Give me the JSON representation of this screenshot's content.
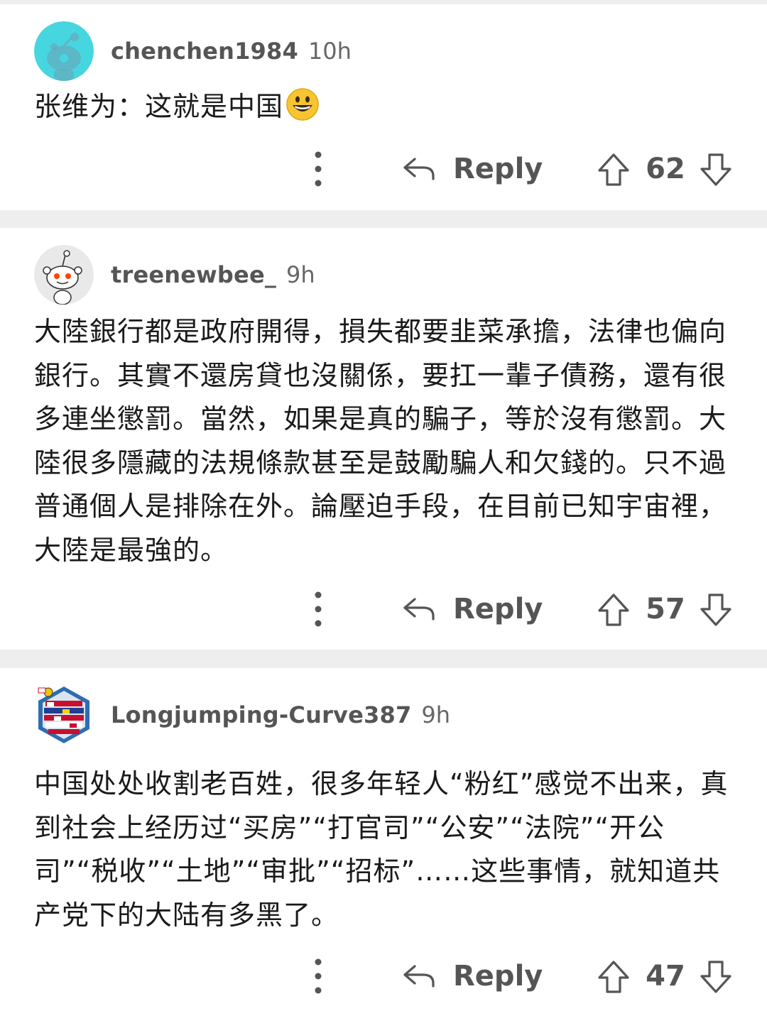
{
  "comments": [
    {
      "author": "chenchen1984",
      "time": "10h",
      "body": "张维为：这就是中国",
      "emoji": "grinning-face",
      "reply_label": "Reply",
      "score": "62",
      "avatar": "snoo-teal-avatar"
    },
    {
      "author": "treenewbee_",
      "time": "9h",
      "body": "大陸銀行都是政府開得，損失都要韭菜承擔，法律也偏向銀行。其實不還房貸也沒關係，要扛一輩子債務，還有很多連坐懲罰。當然，如果是真的騙子，等於沒有懲罰。大陸很多隱藏的法規條款甚至是鼓勵騙人和欠錢的。只不過普通個人是排除在外。論壓迫手段，在目前已知宇宙裡，大陸是最強的。",
      "reply_label": "Reply",
      "score": "57",
      "avatar": "snoo-default-avatar"
    },
    {
      "author": "Longjumping-Curve387",
      "time": "9h",
      "body": "中国处处收割老百姓，很多年轻人“粉红”感觉不出来，真到社会上经历过“买房”“打官司”“公安”“法院”“开公司”“税收”“土地”“审批”“招标”……这些事情，就知道共产党下的大陆有多黑了。",
      "reply_label": "Reply",
      "score": "47",
      "avatar": "flags-avatar"
    }
  ],
  "colors": {
    "background": "#eeeeee",
    "card": "#ffffff",
    "text": "#1a1a1a",
    "meta": "#555555",
    "avatar_teal": "#46d6e0"
  },
  "icons": [
    "more-vertical-icon",
    "reply-arrow-icon",
    "upvote-arrow-icon",
    "downvote-arrow-icon"
  ]
}
